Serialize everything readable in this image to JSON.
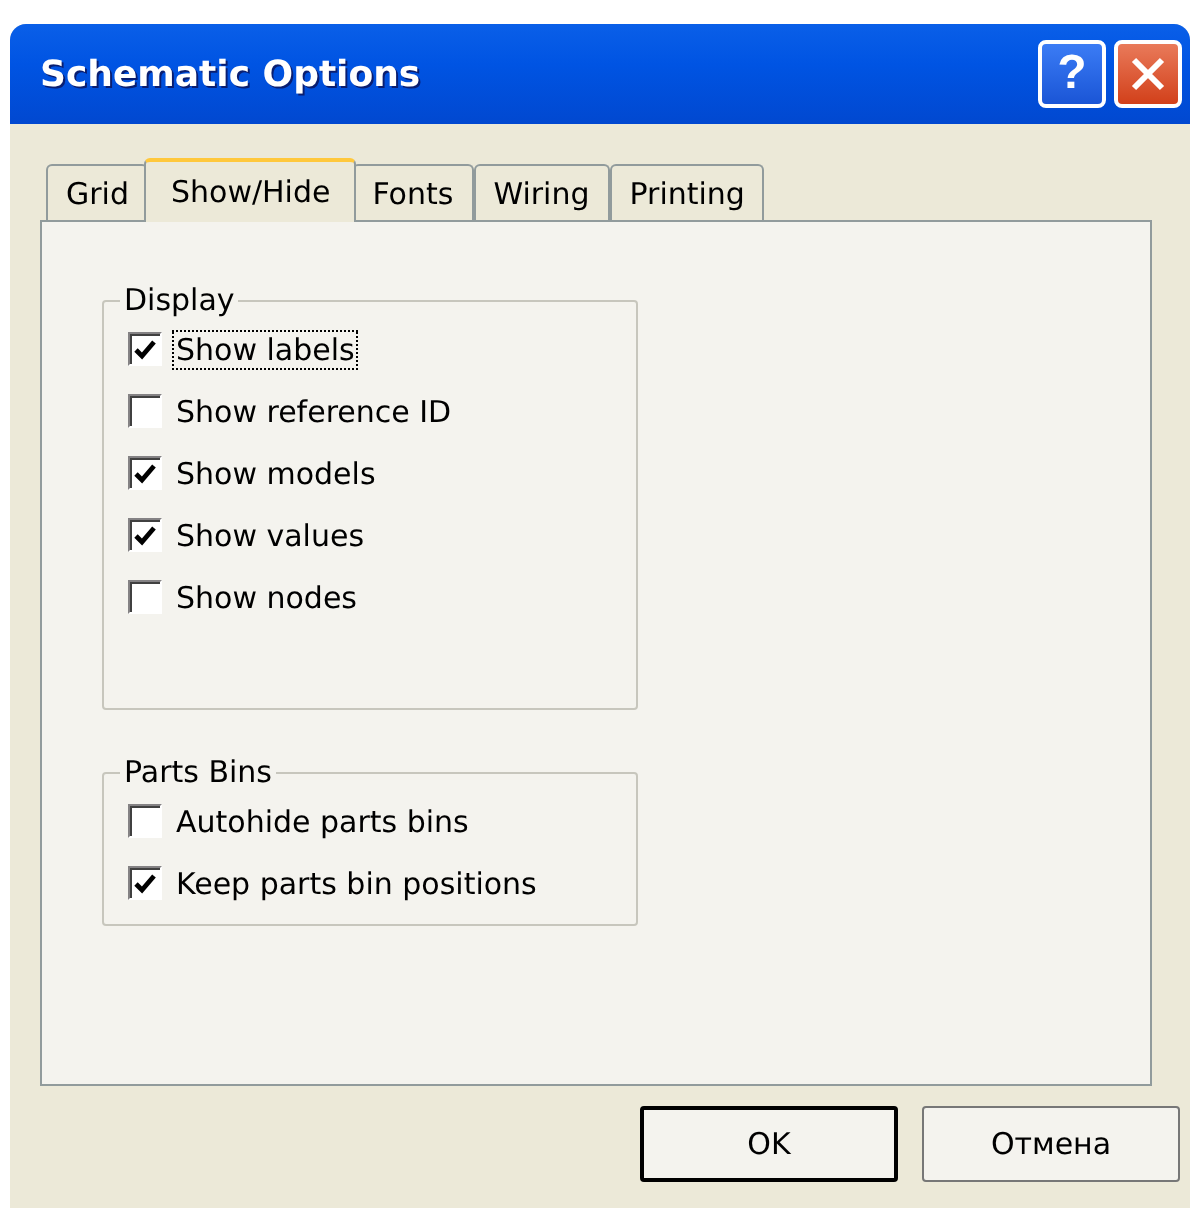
{
  "window": {
    "title": "Schematic Options",
    "title_buttons": [
      {
        "kind": "help",
        "label": "?"
      },
      {
        "kind": "close"
      }
    ]
  },
  "tabs": [
    {
      "label": "Grid",
      "selected": false
    },
    {
      "label": "Show/Hide",
      "selected": true
    },
    {
      "label": "Fonts",
      "selected": false
    },
    {
      "label": "Wiring",
      "selected": false
    },
    {
      "label": "Printing",
      "selected": false
    }
  ],
  "groups": [
    {
      "title": "Display",
      "items": [
        {
          "label": "Show labels",
          "checked": true,
          "focused": true
        },
        {
          "label": "Show reference ID",
          "checked": false,
          "focused": false
        },
        {
          "label": "Show models",
          "checked": true,
          "focused": false
        },
        {
          "label": "Show values",
          "checked": true,
          "focused": false
        },
        {
          "label": "Show nodes",
          "checked": false,
          "focused": false
        }
      ]
    },
    {
      "title": "Parts Bins",
      "items": [
        {
          "label": "Autohide parts bins",
          "checked": false,
          "focused": false
        },
        {
          "label": "Keep parts bin positions",
          "checked": true,
          "focused": false
        }
      ]
    }
  ],
  "buttons": [
    {
      "label": "OK",
      "default": true
    },
    {
      "label": "Отмена",
      "default": false
    }
  ]
}
